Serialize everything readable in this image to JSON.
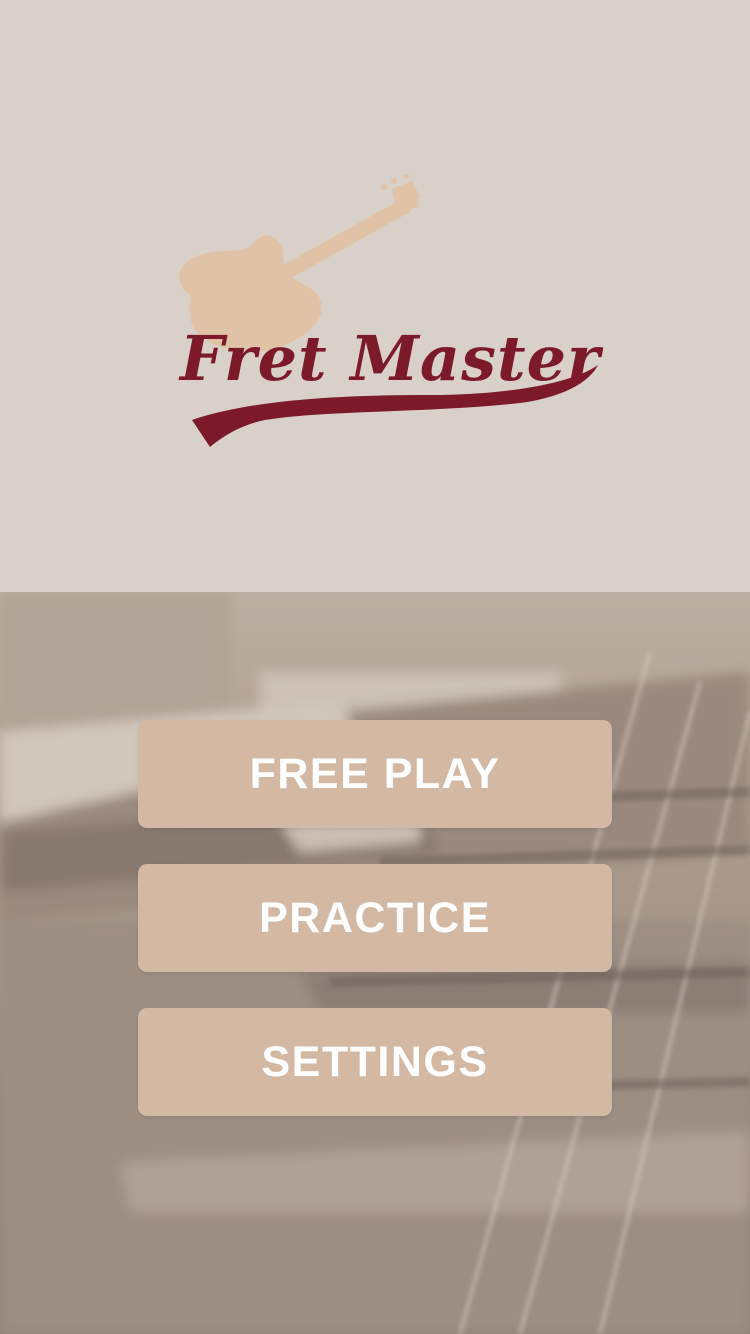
{
  "logo": {
    "text": "Fret Master",
    "colors": {
      "text": "#7c1a2b",
      "guitar": "#e0c3a6"
    }
  },
  "menu": {
    "free_play_label": "FREE PLAY",
    "practice_label": "PRACTICE",
    "settings_label": "SETTINGS"
  },
  "colors": {
    "top_background": "#d8d0c9",
    "button_background": "#d3b9a3",
    "button_text": "#ffffff"
  }
}
